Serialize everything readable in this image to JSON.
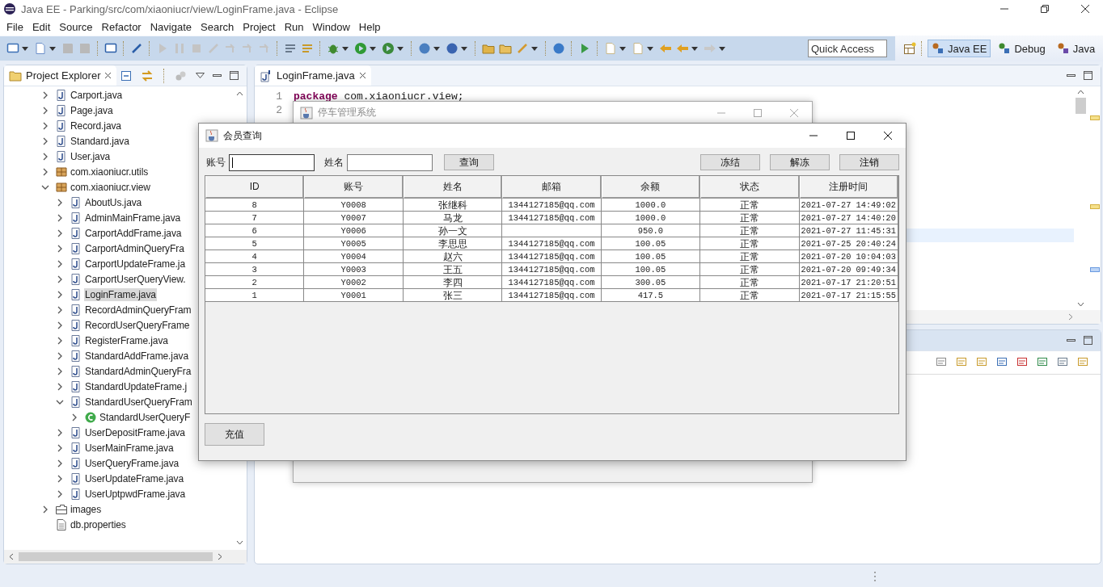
{
  "window": {
    "title": "Java EE - Parking/src/com/xiaoniucr/view/LoginFrame.java - Eclipse"
  },
  "menu": [
    "File",
    "Edit",
    "Source",
    "Refactor",
    "Navigate",
    "Search",
    "Project",
    "Run",
    "Window",
    "Help"
  ],
  "quick_access": {
    "placeholder": "Quick Access"
  },
  "perspectives": [
    {
      "label": "Java EE",
      "selected": true
    },
    {
      "label": "Debug",
      "selected": false
    },
    {
      "label": "Java",
      "selected": false
    }
  ],
  "project_explorer": {
    "title": "Project Explorer",
    "tree": [
      {
        "children": [
          {
            "label": "Carport.java",
            "kind": "java",
            "expanded": false,
            "selected": false
          },
          {
            "label": "Page.java",
            "kind": "java",
            "expanded": false,
            "selected": false
          },
          {
            "label": "Record.java",
            "kind": "java",
            "expanded": false,
            "selected": false
          },
          {
            "label": "Standard.java",
            "kind": "java",
            "expanded": false,
            "selected": false
          },
          {
            "label": "User.java",
            "kind": "java",
            "expanded": false,
            "selected": false
          }
        ]
      },
      {
        "label": "com.xiaoniucr.utils",
        "kind": "package",
        "expanded": false,
        "selected": false
      },
      {
        "label": "com.xiaoniucr.view",
        "kind": "package",
        "expanded": true,
        "selected": false,
        "children": [
          {
            "label": "AboutUs.java",
            "kind": "java",
            "expanded": false,
            "selected": false
          },
          {
            "label": "AdminMainFrame.java",
            "kind": "java",
            "expanded": false,
            "selected": false
          },
          {
            "label": "CarportAddFrame.java",
            "kind": "java",
            "expanded": false,
            "selected": false
          },
          {
            "label": "CarportAdminQueryFra",
            "kind": "java",
            "expanded": false,
            "selected": false
          },
          {
            "label": "CarportUpdateFrame.ja",
            "kind": "java",
            "expanded": false,
            "selected": false
          },
          {
            "label": "CarportUserQueryView.",
            "kind": "java",
            "expanded": false,
            "selected": false
          },
          {
            "label": "LoginFrame.java",
            "kind": "java",
            "expanded": false,
            "selected": true
          },
          {
            "label": "RecordAdminQueryFram",
            "kind": "java",
            "expanded": false,
            "selected": false
          },
          {
            "label": "RecordUserQueryFrame",
            "kind": "java",
            "expanded": false,
            "selected": false
          },
          {
            "label": "RegisterFrame.java",
            "kind": "java",
            "expanded": false,
            "selected": false
          },
          {
            "label": "StandardAddFrame.java",
            "kind": "java",
            "expanded": false,
            "selected": false
          },
          {
            "label": "StandardAdminQueryFra",
            "kind": "java",
            "expanded": false,
            "selected": false
          },
          {
            "label": "StandardUpdateFrame.j",
            "kind": "java",
            "expanded": false,
            "selected": false
          },
          {
            "label": "StandardUserQueryFram",
            "kind": "java",
            "expanded": true,
            "selected": false,
            "children": [
              {
                "label": "StandardUserQueryF",
                "kind": "class",
                "expanded": false,
                "selected": false
              }
            ]
          },
          {
            "label": "UserDepositFrame.java",
            "kind": "java",
            "expanded": false,
            "selected": false
          },
          {
            "label": "UserMainFrame.java",
            "kind": "java",
            "expanded": false,
            "selected": false
          },
          {
            "label": "UserQueryFrame.java",
            "kind": "java",
            "expanded": false,
            "selected": false
          },
          {
            "label": "UserUpdateFrame.java",
            "kind": "java",
            "expanded": false,
            "selected": false
          },
          {
            "label": "UserUptpwdFrame.java",
            "kind": "java",
            "expanded": false,
            "selected": false
          }
        ]
      },
      {
        "label": "images",
        "kind": "folder",
        "expanded": false,
        "selected": false
      },
      {
        "label": "db.properties",
        "kind": "file",
        "selected": false
      }
    ]
  },
  "editor": {
    "tab": "LoginFrame.java",
    "lines": [
      {
        "number": "1",
        "keyword": "package",
        "code": "com.xiaoniucr.view;"
      },
      {
        "number": "2"
      }
    ]
  },
  "back_dialog": {
    "title": "停车管理系统"
  },
  "dialog": {
    "title": "会员查询",
    "fields": [
      {
        "label": "账号",
        "focused": true
      },
      {
        "label": "姓名",
        "focused": false
      }
    ],
    "search_button": "查询",
    "action_buttons": [
      "冻结",
      "解冻",
      "注销"
    ],
    "table": {
      "columns": [
        "ID",
        "账号",
        "姓名",
        "邮箱",
        "余额",
        "状态",
        "注册时间"
      ],
      "rows": [
        {
          "id": "8",
          "account": "Y0008",
          "name": "张继科",
          "email": "1344127185@qq.com",
          "balance": "1000.0",
          "status": "正常",
          "registered": "2021-07-27 14:49:02"
        },
        {
          "id": "7",
          "account": "Y0007",
          "name": "马龙",
          "email": "1344127185@qq.com",
          "balance": "1000.0",
          "status": "正常",
          "registered": "2021-07-27 14:40:20"
        },
        {
          "id": "6",
          "account": "Y0006",
          "name": "孙一文",
          "balance": "950.0",
          "status": "正常",
          "registered": "2021-07-27 11:45:31"
        },
        {
          "id": "5",
          "account": "Y0005",
          "name": "李思思",
          "email": "1344127185@qq.com",
          "balance": "100.05",
          "status": "正常",
          "registered": "2021-07-25 20:40:24"
        },
        {
          "id": "4",
          "account": "Y0004",
          "name": "赵六",
          "email": "1344127185@qq.com",
          "balance": "100.05",
          "status": "正常",
          "registered": "2021-07-20 10:04:03"
        },
        {
          "id": "3",
          "account": "Y0003",
          "name": "王五",
          "email": "1344127185@qq.com",
          "balance": "100.05",
          "status": "正常",
          "registered": "2021-07-20 09:49:34"
        },
        {
          "id": "2",
          "account": "Y0002",
          "name": "李四",
          "email": "1344127185@qq.com",
          "balance": "300.05",
          "status": "正常",
          "registered": "2021-07-17 21:20:51"
        },
        {
          "id": "1",
          "account": "Y0001",
          "name": "张三",
          "email": "1344127185@qq.com",
          "balance": "417.5",
          "status": "正常",
          "registered": "2021-07-17 21:15:55"
        }
      ]
    },
    "bottom_button": "充值"
  }
}
